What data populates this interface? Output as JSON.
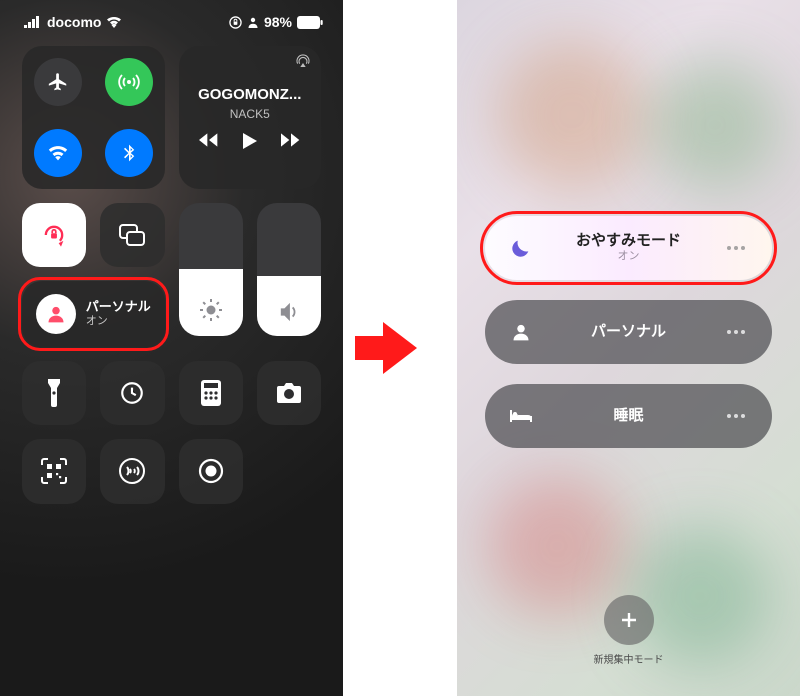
{
  "status": {
    "carrier": "docomo",
    "battery_pct": "98%"
  },
  "connectivity": {
    "airplane": "airplane-icon",
    "cellular": "antenna-icon",
    "wifi": "wifi-icon",
    "bluetooth": "bluetooth-icon"
  },
  "media": {
    "title": "GOGOMONZ...",
    "subtitle": "NACK5"
  },
  "left_focus": {
    "title": "パーソナル",
    "status": "オン"
  },
  "right": {
    "dnd": {
      "title": "おやすみモード",
      "status": "オン"
    },
    "personal": {
      "title": "パーソナル"
    },
    "sleep": {
      "title": "睡眠"
    },
    "add_label": "新規集中モード"
  }
}
